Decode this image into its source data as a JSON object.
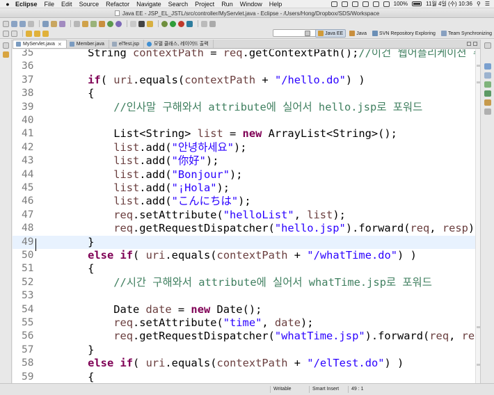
{
  "menubar": {
    "app": "Eclipse",
    "items": [
      "File",
      "Edit",
      "Source",
      "Refactor",
      "Navigate",
      "Search",
      "Project",
      "Run",
      "Window",
      "Help"
    ],
    "battery": "100%",
    "clock": "11월 4일 (수)  10:36"
  },
  "window": {
    "title": "Java EE - JSP_EL_JSTL/src/controller/MyServlet.java - Eclipse - /Users/Hong/Dropbox/SDS/Workspace"
  },
  "perspectives": [
    {
      "label": "Java EE",
      "active": true
    },
    {
      "label": "Java",
      "active": false
    },
    {
      "label": "SVN Repository Exploring",
      "active": false
    },
    {
      "label": "Team Synchronizing",
      "active": false
    }
  ],
  "tabs": [
    {
      "label": "MyServlet.java",
      "active": true,
      "closable": true
    },
    {
      "label": "Member.java",
      "active": false,
      "closable": false
    },
    {
      "label": "elTest.jsp",
      "active": false,
      "closable": false
    },
    {
      "label": "모델 클래스, 레이어드 출력",
      "active": false,
      "closable": false
    }
  ],
  "editor": {
    "lines": [
      {
        "n": "35",
        "tokens": [
          [
            "",
            "        String "
          ],
          [
            "lv",
            "contextPath"
          ],
          [
            "",
            " = "
          ],
          [
            "lv",
            "req"
          ],
          [
            "",
            ".getContextPath();"
          ],
          [
            "cm",
            "//이건 웹어플리케이션 주소"
          ]
        ]
      },
      {
        "n": "36",
        "tokens": []
      },
      {
        "n": "37",
        "tokens": [
          [
            "",
            "        "
          ],
          [
            "kw",
            "if"
          ],
          [
            "",
            "( "
          ],
          [
            "lv",
            "uri"
          ],
          [
            "",
            ".equals("
          ],
          [
            "lv",
            "contextPath"
          ],
          [
            "",
            " + "
          ],
          [
            "str",
            "\"/hello.do\""
          ],
          [
            "",
            ") )"
          ]
        ]
      },
      {
        "n": "38",
        "tokens": [
          [
            "",
            "        {"
          ]
        ]
      },
      {
        "n": "39",
        "tokens": [
          [
            "cm",
            "            //인사말 구해와서 attribute에 실어서 hello.jsp로 포워드"
          ]
        ]
      },
      {
        "n": "40",
        "tokens": []
      },
      {
        "n": "41",
        "tokens": [
          [
            "",
            "            List<String> "
          ],
          [
            "lv",
            "list"
          ],
          [
            "",
            " = "
          ],
          [
            "kw",
            "new"
          ],
          [
            "",
            " ArrayList<String>();"
          ]
        ]
      },
      {
        "n": "42",
        "tokens": [
          [
            "",
            "            "
          ],
          [
            "lv",
            "list"
          ],
          [
            "",
            ".add("
          ],
          [
            "str",
            "\"안녕하세요\""
          ],
          [
            "",
            ");"
          ]
        ]
      },
      {
        "n": "43",
        "tokens": [
          [
            "",
            "            "
          ],
          [
            "lv",
            "list"
          ],
          [
            "",
            ".add("
          ],
          [
            "str",
            "\"你好\""
          ],
          [
            "",
            ");"
          ]
        ]
      },
      {
        "n": "44",
        "tokens": [
          [
            "",
            "            "
          ],
          [
            "lv",
            "list"
          ],
          [
            "",
            ".add("
          ],
          [
            "str",
            "\"Bonjour\""
          ],
          [
            "",
            ");"
          ]
        ]
      },
      {
        "n": "45",
        "tokens": [
          [
            "",
            "            "
          ],
          [
            "lv",
            "list"
          ],
          [
            "",
            ".add("
          ],
          [
            "str",
            "\"¡Hola\""
          ],
          [
            "",
            ");"
          ]
        ]
      },
      {
        "n": "46",
        "tokens": [
          [
            "",
            "            "
          ],
          [
            "lv",
            "list"
          ],
          [
            "",
            ".add("
          ],
          [
            "str",
            "\"こんにちは\""
          ],
          [
            "",
            ");"
          ]
        ]
      },
      {
        "n": "47",
        "tokens": [
          [
            "",
            "            "
          ],
          [
            "lv",
            "req"
          ],
          [
            "",
            ".setAttribute("
          ],
          [
            "str",
            "\"helloList\""
          ],
          [
            "",
            ", "
          ],
          [
            "lv",
            "list"
          ],
          [
            "",
            ");"
          ]
        ]
      },
      {
        "n": "48",
        "tokens": [
          [
            "",
            "            "
          ],
          [
            "lv",
            "req"
          ],
          [
            "",
            ".getRequestDispatcher("
          ],
          [
            "str",
            "\"hello.jsp\""
          ],
          [
            "",
            ").forward("
          ],
          [
            "lv",
            "req"
          ],
          [
            "",
            ", "
          ],
          [
            "lv",
            "resp"
          ],
          [
            "",
            ");"
          ]
        ]
      },
      {
        "n": "49",
        "current": true,
        "tokens": [
          [
            "",
            "        }"
          ]
        ]
      },
      {
        "n": "50",
        "tokens": [
          [
            "",
            "        "
          ],
          [
            "kw",
            "else"
          ],
          [
            "",
            " "
          ],
          [
            "kw",
            "if"
          ],
          [
            "",
            "( "
          ],
          [
            "lv",
            "uri"
          ],
          [
            "",
            ".equals("
          ],
          [
            "lv",
            "contextPath"
          ],
          [
            "",
            " + "
          ],
          [
            "str",
            "\"/whatTime.do\""
          ],
          [
            "",
            ") )"
          ]
        ]
      },
      {
        "n": "51",
        "tokens": [
          [
            "",
            "        {"
          ]
        ]
      },
      {
        "n": "52",
        "tokens": [
          [
            "cm",
            "            //시간 구해와서 attribute에 실어서 whatTime.jsp로 포워드"
          ]
        ]
      },
      {
        "n": "53",
        "tokens": []
      },
      {
        "n": "54",
        "tokens": [
          [
            "",
            "            Date "
          ],
          [
            "lv",
            "date"
          ],
          [
            "",
            " = "
          ],
          [
            "kw",
            "new"
          ],
          [
            "",
            " Date();"
          ]
        ]
      },
      {
        "n": "55",
        "tokens": [
          [
            "",
            "            "
          ],
          [
            "lv",
            "req"
          ],
          [
            "",
            ".setAttribute("
          ],
          [
            "str",
            "\"time\""
          ],
          [
            "",
            ", "
          ],
          [
            "lv",
            "date"
          ],
          [
            "",
            ");"
          ]
        ]
      },
      {
        "n": "56",
        "tokens": [
          [
            "",
            "            "
          ],
          [
            "lv",
            "req"
          ],
          [
            "",
            ".getRequestDispatcher("
          ],
          [
            "str",
            "\"whatTime.jsp\""
          ],
          [
            "",
            ").forward("
          ],
          [
            "lv",
            "req"
          ],
          [
            "",
            ", "
          ],
          [
            "lv",
            "resp"
          ],
          [
            "",
            ");"
          ]
        ]
      },
      {
        "n": "57",
        "tokens": [
          [
            "",
            "        }"
          ]
        ]
      },
      {
        "n": "58",
        "tokens": [
          [
            "",
            "        "
          ],
          [
            "kw",
            "else"
          ],
          [
            "",
            " "
          ],
          [
            "kw",
            "if"
          ],
          [
            "",
            "( "
          ],
          [
            "lv",
            "uri"
          ],
          [
            "",
            ".equals("
          ],
          [
            "lv",
            "contextPath"
          ],
          [
            "",
            " + "
          ],
          [
            "str",
            "\"/elTest.do\""
          ],
          [
            "",
            ") )"
          ]
        ]
      },
      {
        "n": "59",
        "tokens": [
          [
            "",
            "        {"
          ]
        ]
      }
    ]
  },
  "status": {
    "mode": "Writable",
    "insert": "Smart Insert",
    "position": "49 : 1"
  },
  "colors": {
    "keyword": "#7f0055",
    "string": "#2a00ff",
    "comment": "#3f7f5f",
    "local_variable": "#6a3e3e",
    "current_line": "#e8f2fe"
  }
}
